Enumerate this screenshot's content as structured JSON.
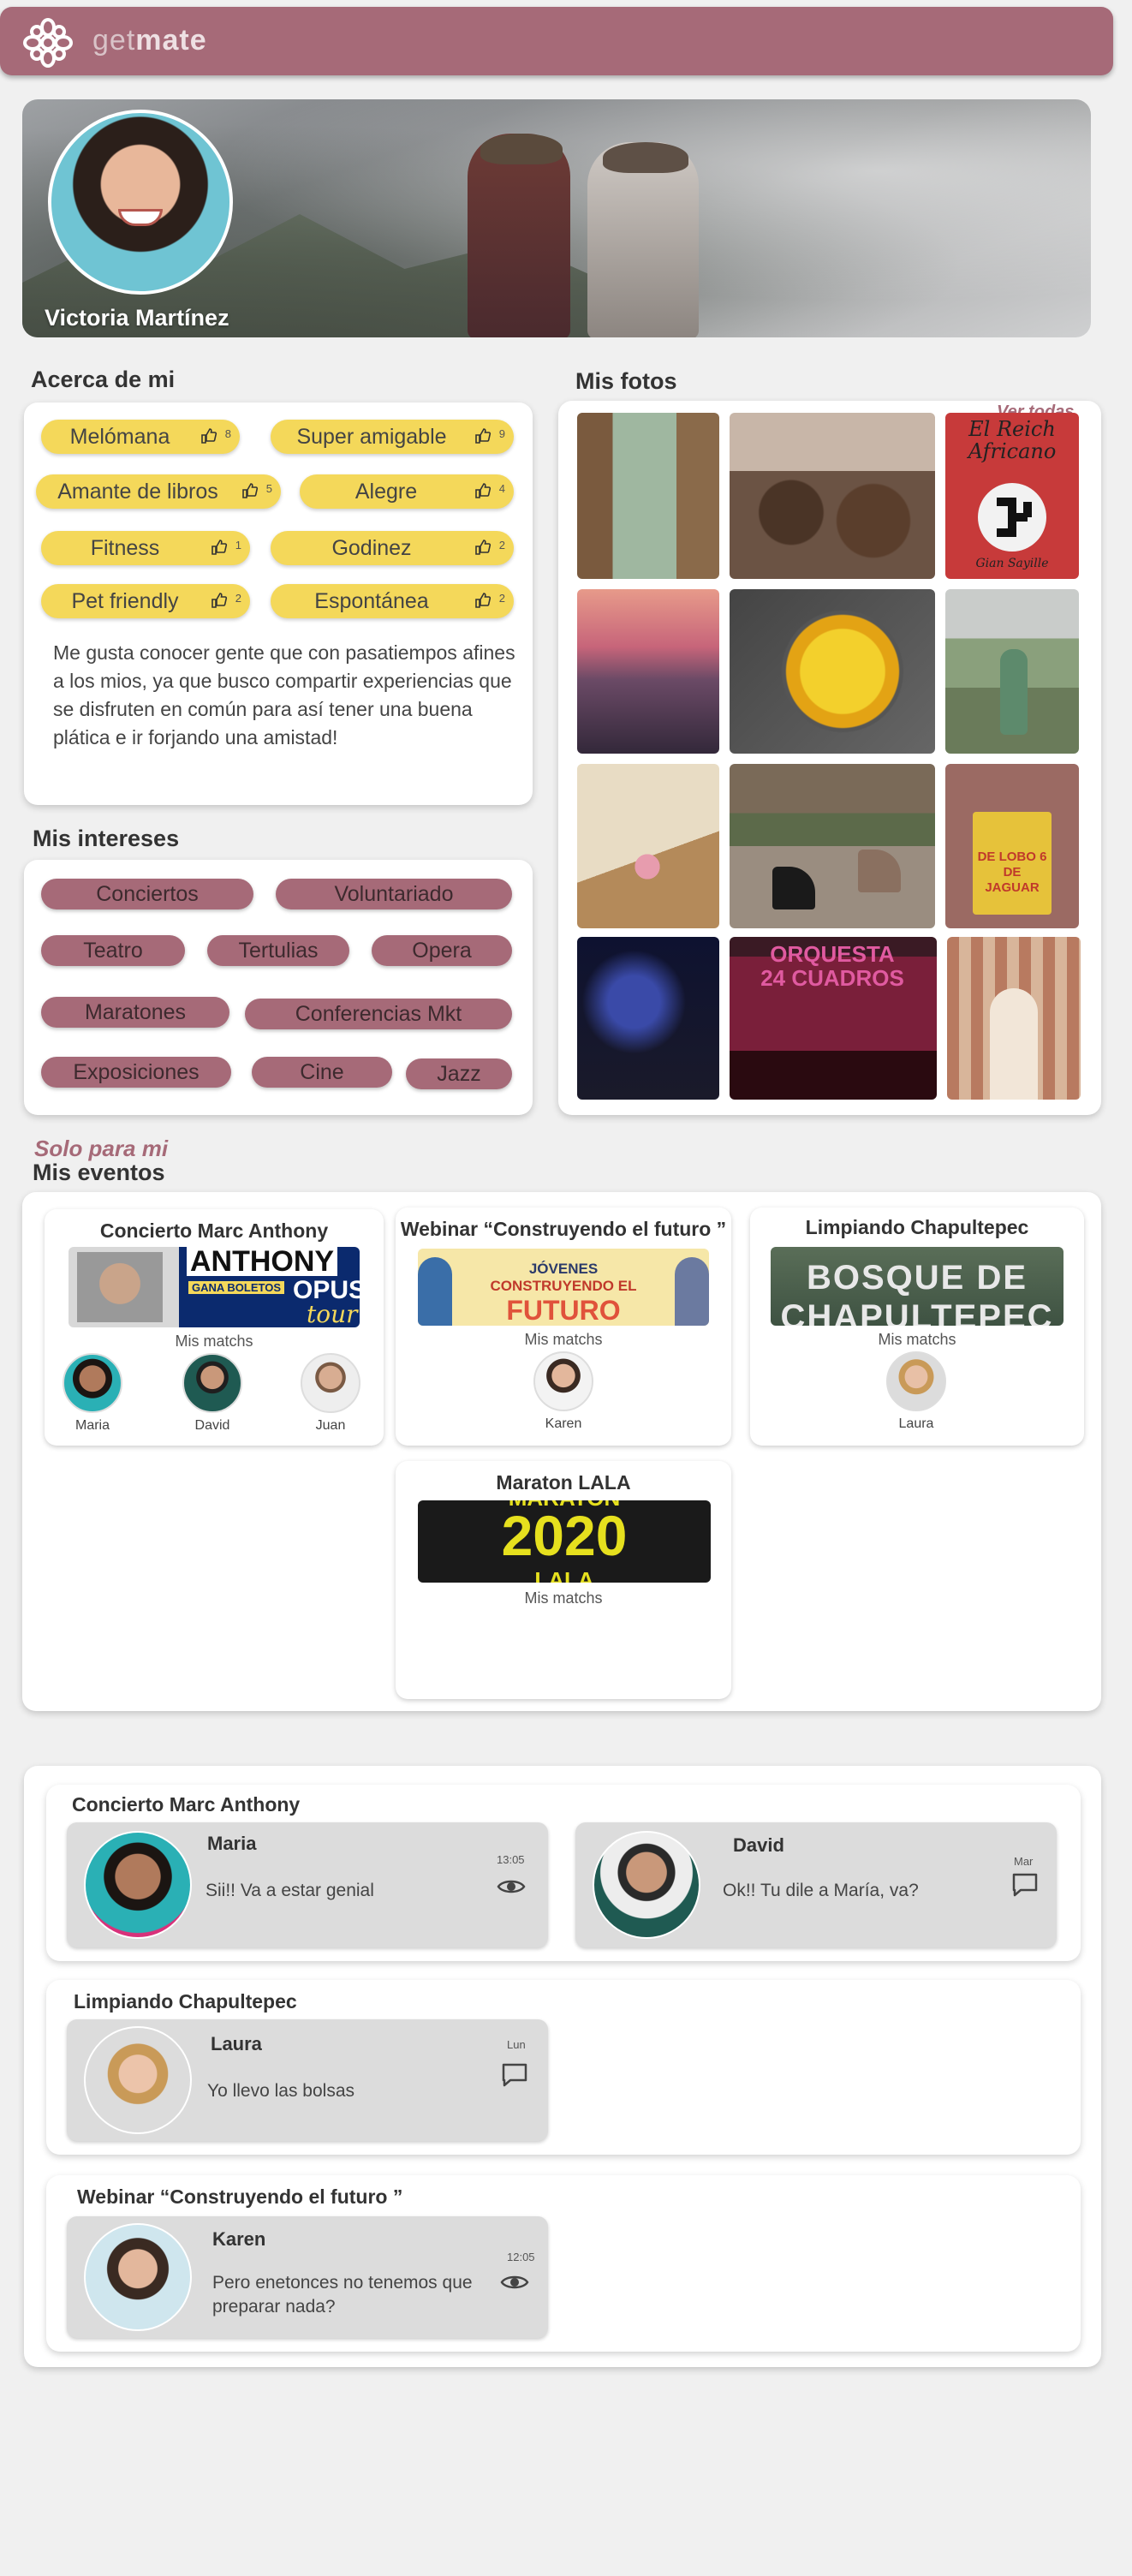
{
  "brand": {
    "prefix": "get",
    "name": "mate"
  },
  "profile": {
    "name": "Victoria Martínez"
  },
  "about": {
    "title": "Acerca de mi",
    "traits": [
      {
        "label": "Melómana",
        "count": "8"
      },
      {
        "label": "Super amigable",
        "count": "9"
      },
      {
        "label": "Amante de libros",
        "count": "5"
      },
      {
        "label": "Alegre",
        "count": "4"
      },
      {
        "label": "Fitness",
        "count": "1"
      },
      {
        "label": "Godinez",
        "count": "2"
      },
      {
        "label": "Pet friendly",
        "count": "2"
      },
      {
        "label": "Espontánea",
        "count": "2"
      }
    ],
    "text": "Me gusta conocer gente que con pasatiempos afines a los mios, ya que busco compartir experiencias que se disfruten en común para así tener una buena plática e ir forjando una amistad!"
  },
  "interests": {
    "title": "Mis intereses",
    "items": [
      "Conciertos",
      "Voluntariado",
      "Teatro",
      "Tertulias",
      "Opera",
      "Maratones",
      "Conferencias Mkt",
      "Exposiciones",
      "Cine",
      "Jazz"
    ]
  },
  "photos": {
    "title": "Mis fotos",
    "see_all": "Ver todas",
    "overlay_texts": {
      "book": "El Reich Africano",
      "book_author": "Gian Sayille",
      "sign": "DE LOBO 6 DE JAGUAR",
      "screen": "ORQUESTA 24 CUADROS"
    }
  },
  "events": {
    "kicker": "Solo para mi",
    "title": "Mis eventos",
    "matches_label": "Mis matchs",
    "items": [
      {
        "title": "Concierto Marc Anthony",
        "banner": [
          "ANTHONY",
          "GANA BOLETOS",
          "OPUS",
          "tour"
        ],
        "matches": [
          "Maria",
          "David",
          "Juan"
        ]
      },
      {
        "title": "Webinar “Construyendo el futuro ”",
        "banner": [
          "JÓVENES",
          "CONSTRUYENDO EL",
          "FUTURO"
        ],
        "matches": [
          "Karen"
        ]
      },
      {
        "title": "Limpiando Chapultepec",
        "banner": [
          "BOSQUE DE",
          "CHAPULTEPEC"
        ],
        "matches": [
          "Laura"
        ]
      },
      {
        "title": "Maraton LALA",
        "banner": [
          "MARATON",
          "2020",
          "LALA"
        ],
        "matches": []
      }
    ]
  },
  "chats": [
    {
      "title": "Concierto Marc Anthony",
      "items": [
        {
          "name": "Maria",
          "message": "Sii!! Va a estar genial",
          "time": "13:05",
          "icon": "eye-icon"
        },
        {
          "name": "David",
          "message": "Ok!! Tu dile a María, va?",
          "time": "Mar",
          "icon": "chat-bubble-icon"
        }
      ]
    },
    {
      "title": "Limpiando Chapultepec",
      "items": [
        {
          "name": "Laura",
          "message": "Yo llevo las bolsas",
          "time": "Lun",
          "icon": "chat-bubble-icon"
        }
      ]
    },
    {
      "title": "Webinar “Construyendo el futuro ”",
      "items": [
        {
          "name": "Karen",
          "message": "Pero enetonces no tenemos que preparar nada?",
          "time": "12:05",
          "icon": "eye-icon"
        }
      ]
    }
  ],
  "colors": {
    "brand": "#a66a78",
    "trait_pill": "#f4d85a",
    "background": "#f0f0f0"
  }
}
